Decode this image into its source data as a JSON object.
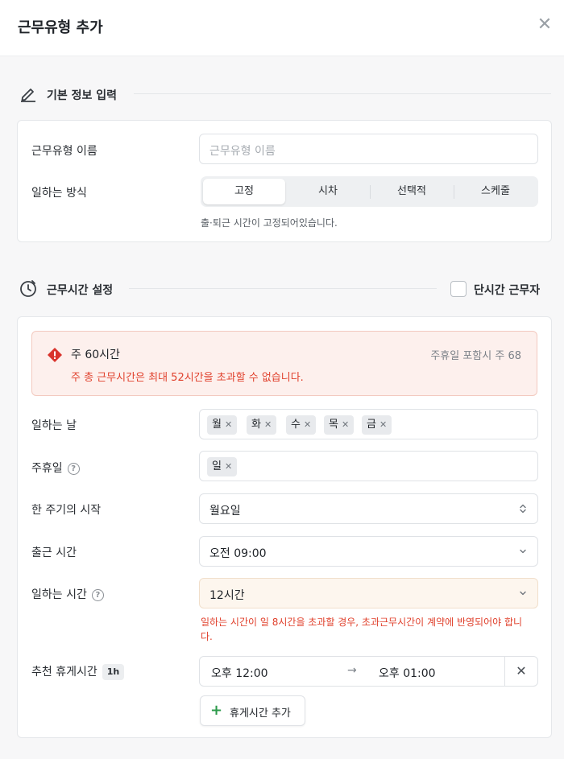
{
  "modal": {
    "title": "근무유형 추가",
    "close_icon": "close-icon"
  },
  "basic": {
    "section_title": "기본 정보 입력",
    "name_label": "근무유형 이름",
    "name_placeholder": "근무유형 이름",
    "method_label": "일하는 방식",
    "method_options": [
      "고정",
      "시차",
      "선택적",
      "스케줄"
    ],
    "method_selected": "고정",
    "method_hint": "출·퇴근 시간이 고정되어있습니다."
  },
  "worktime": {
    "section_title": "근무시간 설정",
    "short_time_label": "단시간 근무자",
    "short_time_checked": false,
    "alert": {
      "title": "주 60시간",
      "right": "주휴일 포함시 주 68",
      "message": "주 총 근무시간은 최대 52시간을 초과할 수 없습니다."
    },
    "days_label": "일하는 날",
    "days": [
      "월",
      "화",
      "수",
      "목",
      "금"
    ],
    "holiday_label": "주휴일",
    "holidays": [
      "일"
    ],
    "week_start_label": "한 주기의 시작",
    "week_start_value": "월요일",
    "start_time_label": "출근 시간",
    "start_time_value": "오전 09:00",
    "work_hours_label": "일하는 시간",
    "work_hours_value": "12시간",
    "work_hours_error": "일하는 시간이 일 8시간을 초과할 경우, 초과근무시간이 계약에 반영되어야 합니다.",
    "break_label": "추천 휴게시간",
    "break_badge": "1h",
    "break_from": "오후 12:00",
    "break_arrow": "→",
    "break_to": "오후 01:00",
    "add_break_label": "휴게시간 추가"
  },
  "colors": {
    "error": "#e0402c",
    "alert_bg": "#fdf0ed",
    "accent_green": "#2c9a4b"
  }
}
